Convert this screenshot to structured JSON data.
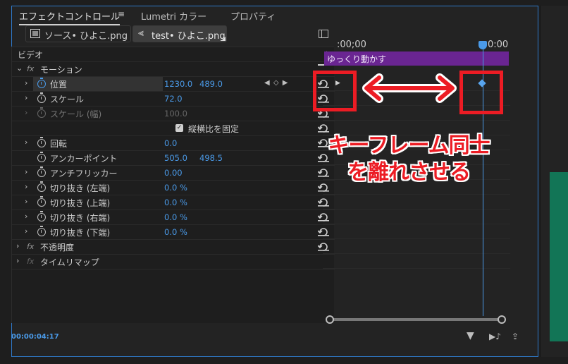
{
  "tabs": [
    {
      "label": "エフェクトコントロール"
    },
    {
      "label": "Lumetri カラー"
    },
    {
      "label": "プロパティ"
    }
  ],
  "tab_menu_glyph": "≡",
  "source": {
    "master_label": "ソース• ひよこ.png",
    "clip_label": "test• ひよこ.png"
  },
  "section_label": "ビデオ",
  "rows": {
    "motion": {
      "label": "モーション"
    },
    "position": {
      "label": "位置",
      "x": "1230.0",
      "y": "489.0"
    },
    "scale": {
      "label": "スケール",
      "value": "72.0"
    },
    "scale_width": {
      "label": "スケール (幅)",
      "value": "100.0"
    },
    "uniform": {
      "label": "縦横比を固定",
      "checked": true
    },
    "rotation": {
      "label": "回転",
      "value": "0.0"
    },
    "anchor": {
      "label": "アンカーポイント",
      "x": "505.0",
      "y": "498.5"
    },
    "antiflicker": {
      "label": "アンチフリッカー",
      "value": "0.00"
    },
    "crop_left": {
      "label": "切り抜き (左端)",
      "value": "0.0 %"
    },
    "crop_top": {
      "label": "切り抜き (上端)",
      "value": "0.0 %"
    },
    "crop_right": {
      "label": "切り抜き (右端)",
      "value": "0.0 %"
    },
    "crop_bottom": {
      "label": "切り抜き (下端)",
      "value": "0.0 %"
    },
    "opacity": {
      "label": "不透明度"
    },
    "time_remap": {
      "label": "タイムリマップ"
    }
  },
  "timeline": {
    "start_tc": ":00;00",
    "end_tc": "0:00",
    "clip_name": "ゆっくり動かす"
  },
  "current_time": "00:00:04:17",
  "annotation": {
    "line1": "キーフレーム同士",
    "line2": "を離れさせる",
    "color": "#ec1c24"
  },
  "colors": {
    "accent": "#4a9ae8",
    "clip": "#6a2592",
    "panel_border": "#2f79c9"
  }
}
